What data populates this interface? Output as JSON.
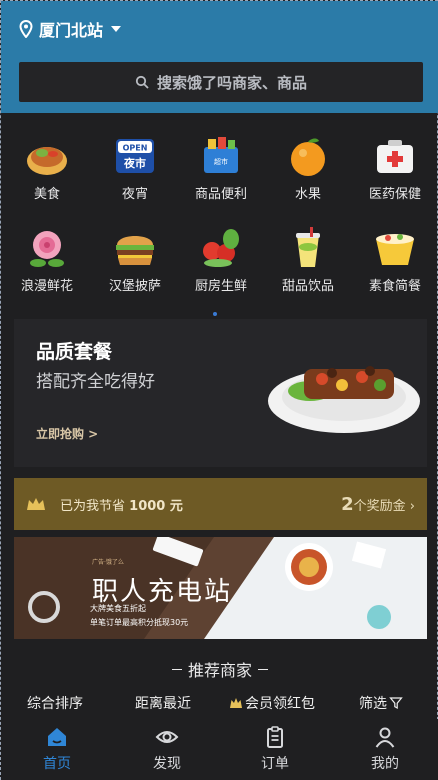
{
  "header": {
    "location": "厦门北站",
    "search_placeholder": "搜索饿了吗商家、商品"
  },
  "categories": [
    {
      "label": "美食",
      "icon": "food-icon"
    },
    {
      "label": "夜宵",
      "icon": "night-snack-icon",
      "badge_top": "OPEN",
      "badge_bottom": "夜市"
    },
    {
      "label": "商品便利",
      "icon": "convenience-store-icon",
      "badge": "超市"
    },
    {
      "label": "水果",
      "icon": "fruit-icon"
    },
    {
      "label": "医药保健",
      "icon": "medicine-icon"
    },
    {
      "label": "浪漫鲜花",
      "icon": "flower-icon"
    },
    {
      "label": "汉堡披萨",
      "icon": "burger-icon"
    },
    {
      "label": "厨房生鲜",
      "icon": "fresh-produce-icon"
    },
    {
      "label": "甜品饮品",
      "icon": "drink-icon"
    },
    {
      "label": "素食简餐",
      "icon": "simple-meal-icon"
    }
  ],
  "promo": {
    "title": "品质套餐",
    "subtitle": "搭配齐全吃得好",
    "cta": "立即抢购 >"
  },
  "savings": {
    "prefix": "已为我节省",
    "amount": "1000 元",
    "reward_count": "2",
    "reward_label": "个奖励金",
    "chevron": "›"
  },
  "banner": {
    "tag": "广告·饿了么",
    "title": "职人充电站",
    "line1": "大牌美食五折起",
    "line2": "单笔订单最高积分抵现30元"
  },
  "recommend": {
    "title": "推荐商家"
  },
  "filters": [
    {
      "label": "综合排序"
    },
    {
      "label": "距离最近"
    },
    {
      "label": "会员领红包",
      "icon": "crown-icon"
    },
    {
      "label": "筛选",
      "icon": "filter-icon"
    }
  ],
  "tabs": [
    {
      "label": "首页",
      "icon": "home-icon",
      "active": true
    },
    {
      "label": "发现",
      "icon": "discover-icon",
      "active": false
    },
    {
      "label": "订单",
      "icon": "order-icon",
      "active": false
    },
    {
      "label": "我的",
      "icon": "user-icon",
      "active": false
    }
  ],
  "colors": {
    "header_bg": "#2b7ba8",
    "page_bg": "#1f1f21",
    "active_tab": "#2f86d6",
    "savings_bg": "#6e5a25"
  }
}
